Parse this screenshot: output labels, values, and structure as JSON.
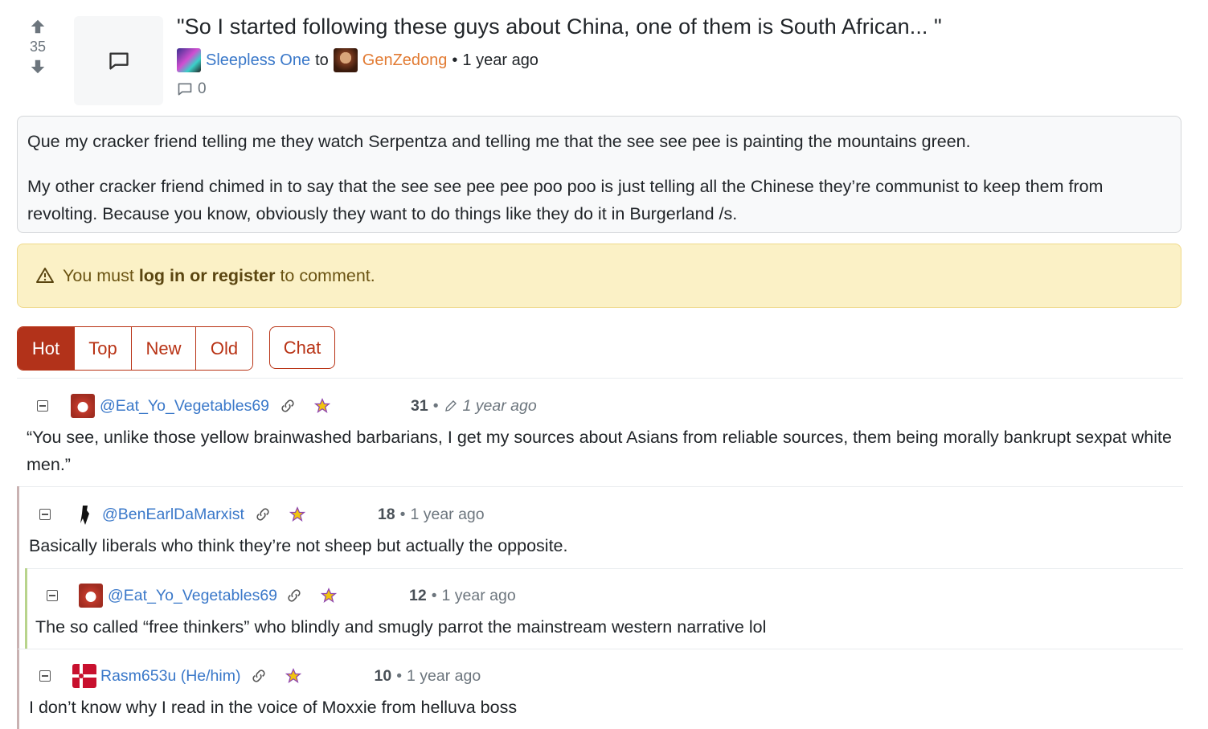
{
  "post": {
    "score": "35",
    "title": "\"So I started following these guys about China, one of them is South African... \"",
    "author": "Sleepless One",
    "to": "to",
    "community": "GenZedong",
    "separator": "•",
    "time": "1 year ago",
    "comment_count": "0",
    "body_p1": "Que my cracker friend telling me they watch Serpentza and telling me that the see see pee is painting the mountains green.",
    "body_p2": "My other cracker friend chimed in to say that the see see pee pee poo poo is just telling all the Chinese they’re communist to keep them from revolting. Because you know, obviously they want to do things like they do it in Burgerland /s."
  },
  "alert": {
    "prefix": "You must ",
    "link": "log in or register",
    "suffix": " to comment."
  },
  "sort": {
    "options": [
      "Hot",
      "Top",
      "New",
      "Old"
    ],
    "active": "Hot",
    "chat": "Chat"
  },
  "comments": [
    {
      "user": "@Eat_Yo_Vegetables69",
      "score": "31",
      "dot": "•",
      "time": "1 year ago",
      "edited": true,
      "text": "“You see, unlike those yellow brainwashed barbarians, I get my sources about Asians from reliable sources, them being morally bankrupt sexpat white men.”"
    },
    {
      "user": "@BenEarlDaMarxist",
      "score": "18",
      "dot": "•",
      "time": "1 year ago",
      "text": "Basically liberals who think they’re not sheep but actually the opposite."
    },
    {
      "user": "@Eat_Yo_Vegetables69",
      "score": "12",
      "dot": "•",
      "time": "1 year ago",
      "text": "The so called “free thinkers” who blindly and smugly parrot the mainstream western narrative lol"
    },
    {
      "user": "Rasm653u (He/him)",
      "score": "10",
      "dot": "•",
      "time": "1 year ago",
      "text": "I don’t know why I read in the voice of Moxxie from helluva boss"
    }
  ],
  "colors": {
    "accent": "#b2321a",
    "link": "#3a78c9",
    "community": "#e27b33",
    "alert_bg": "#fbf1c6",
    "thread_level1": "#c9b2b2",
    "thread_level2": "#b8d48c"
  },
  "icons": [
    "upvote-icon",
    "downvote-icon",
    "message-icon",
    "comment-icon",
    "warning-icon",
    "collapse-icon",
    "link-icon",
    "fediverse-icon",
    "edit-icon"
  ]
}
